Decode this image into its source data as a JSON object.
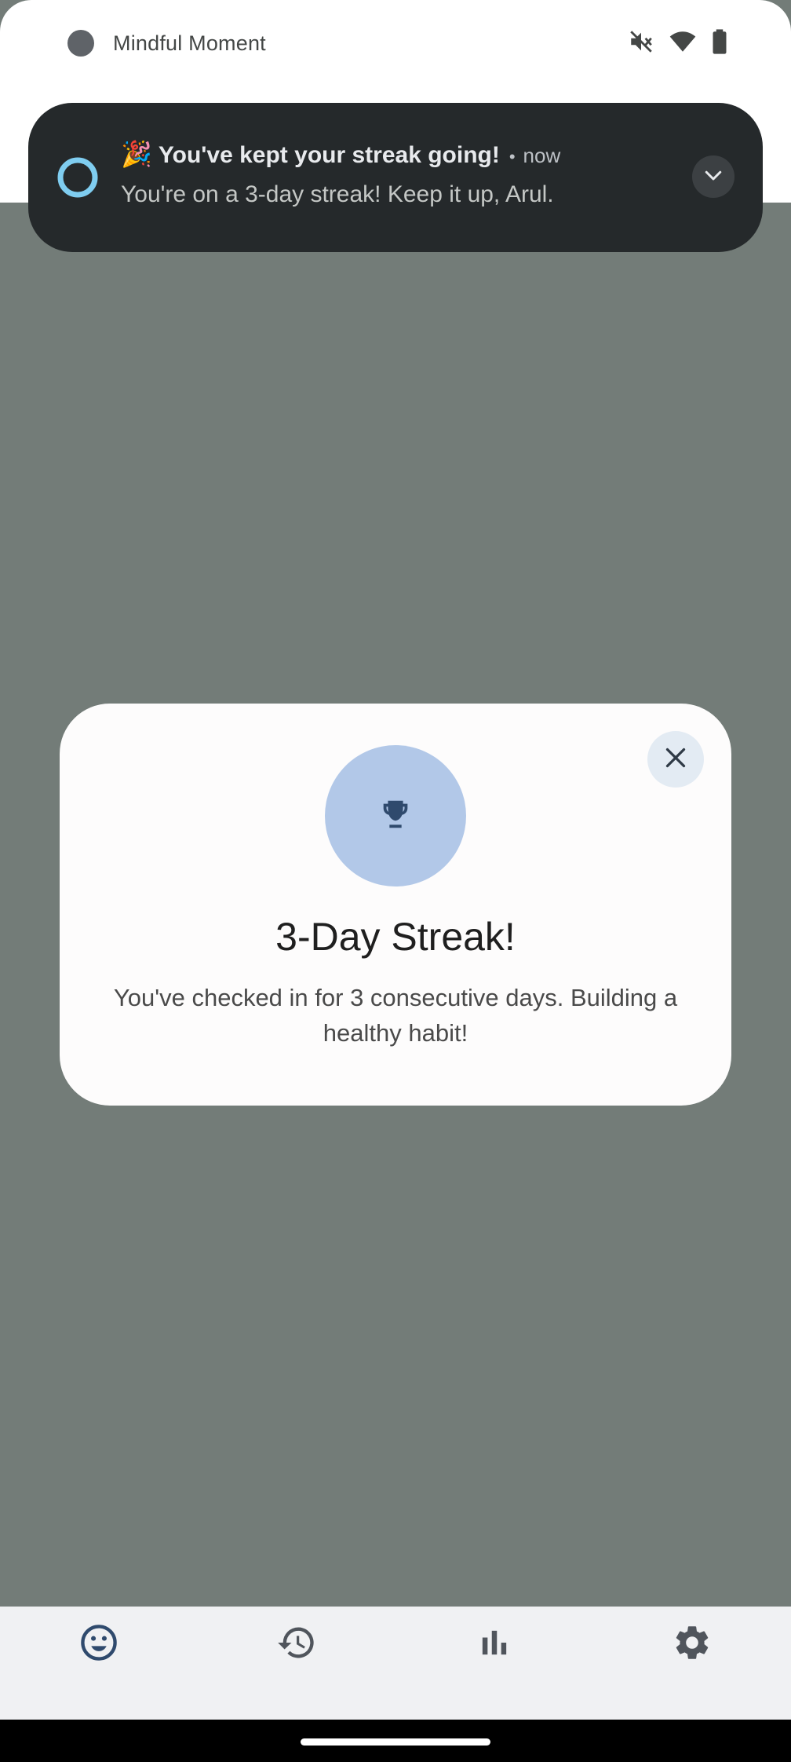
{
  "status_bar": {
    "app_name": "Mindful Moment",
    "icons": [
      "mute-icon",
      "wifi-icon",
      "battery-icon"
    ]
  },
  "notification": {
    "emoji": "🎉",
    "title": "You've kept your streak going!",
    "separator": "•",
    "time": "now",
    "body": "You're on a 3-day streak! Keep it up, Arul.",
    "icon": "ring-icon",
    "expand_icon": "chevron-down-icon"
  },
  "dialog": {
    "icon": "trophy-icon",
    "title": "3-Day Streak!",
    "message": "You've checked in for 3 consecutive days. Building a healthy habit!",
    "close_icon": "close-icon"
  },
  "bottom_nav": {
    "items": [
      {
        "icon": "mood-icon",
        "selected": true
      },
      {
        "icon": "history-icon",
        "selected": false
      },
      {
        "icon": "bar-chart-icon",
        "selected": false
      },
      {
        "icon": "settings-icon",
        "selected": false
      }
    ]
  },
  "colors": {
    "scrim": "#737c78",
    "notification_bg": "#25292b",
    "dialog_bg": "#fdfcfc",
    "trophy_circle": "#b2c8e8",
    "accent_dark_blue": "#2f4a6d",
    "ring_blue": "#7fcdf0",
    "nav_bg": "#f0f1f3"
  }
}
